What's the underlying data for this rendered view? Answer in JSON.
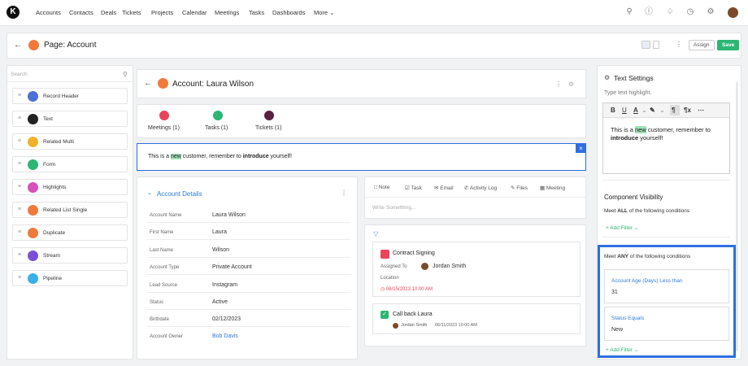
{
  "topnav": {
    "logo": "K",
    "items": [
      "Accounts",
      "Contacts",
      "Deals",
      "Tickets",
      "Projects",
      "Calendar",
      "Meetings",
      "Tasks",
      "Dashboards",
      "More ⌄"
    ]
  },
  "header": {
    "back": "←",
    "title": "Page: Account",
    "kebab": "⋮",
    "assign": "Assign",
    "save": "Save"
  },
  "left": {
    "search_placeholder": "Search",
    "components": [
      {
        "label": "Record Header",
        "color": "#4a6fd8"
      },
      {
        "label": "Text",
        "color": "#222222"
      },
      {
        "label": "Related Multi",
        "color": "#f2b12a"
      },
      {
        "label": "Form",
        "color": "#2bb673"
      },
      {
        "label": "Highlights",
        "color": "#d94fb8"
      },
      {
        "label": "Related List Single",
        "color": "#f07a3c"
      },
      {
        "label": "Duplicate",
        "color": "#f07a3c"
      },
      {
        "label": "Stream",
        "color": "#7a4fd8"
      },
      {
        "label": "Pipeline",
        "color": "#3ab0e8"
      }
    ]
  },
  "record": {
    "back": "←",
    "title": "Account: Laura Wilson",
    "related": [
      {
        "label": "Meetings (1)",
        "color": "#e8445a"
      },
      {
        "label": "Tasks (1)",
        "color": "#2bb673"
      },
      {
        "label": "Tickets (1)",
        "color": "#5a2040"
      }
    ],
    "text_before": "This is a ",
    "text_highlight": "new",
    "text_mid": " customer, remember to ",
    "text_bold": "introduce",
    "text_after": " yourself!"
  },
  "details": {
    "title": "Account Details",
    "fields": [
      {
        "label": "Account Name",
        "value": "Laura Wilson"
      },
      {
        "label": "First Name",
        "value": "Laura"
      },
      {
        "label": "Last Name",
        "value": "Wilson"
      },
      {
        "label": "Account Type",
        "value": "Private Account"
      },
      {
        "label": "Lead Source",
        "value": "Instagram"
      },
      {
        "label": "Status",
        "value": "Active"
      },
      {
        "label": "Birthdate",
        "value": "02/12/2023"
      },
      {
        "label": "Account Owner",
        "value": "Bob Davis"
      }
    ]
  },
  "activity": {
    "tabs": [
      "Note",
      "Task",
      "Email",
      "Activity Log",
      "Files",
      "Meeting"
    ],
    "placeholder": "Write Something...",
    "meeting": {
      "title": "Contract Signing",
      "assigned_label": "Assigned To",
      "assignee": "Jordan Smith",
      "location_label": "Location",
      "datetime": "06/15/2023 10:00 AM"
    },
    "task": {
      "title": "Call back Laura",
      "assignee": "Jordan Smith",
      "datetime": "06/11/2023 10:00 AM"
    }
  },
  "settings": {
    "title": "Text Settings",
    "hint": "Type text highlight.",
    "toolbar": [
      "B",
      "U",
      "A",
      "⌄",
      "✎",
      "⌄",
      "¶",
      "¶x",
      "⋯"
    ],
    "editor_before": "This is a ",
    "editor_highlight": "new",
    "editor_mid": " customer, remember to ",
    "editor_bold": "introduce",
    "editor_after": " yourself!",
    "visibility_title": "Component Visibility",
    "meet_all_prefix": "Meet ",
    "meet_all_bold": "ALL",
    "meet_all_suffix": " of the following conditions",
    "add_filter": "+ Add Filter ⌄",
    "meet_any_prefix": "Meet ",
    "meet_any_bold": "ANY",
    "meet_any_suffix": " of the following conditions",
    "conditions": [
      {
        "field": "Account Age (Days) Less than",
        "value": "31"
      },
      {
        "field": "Status Equals",
        "value": "New"
      }
    ],
    "add_filter_2": "+ Add Filter ⌄"
  }
}
